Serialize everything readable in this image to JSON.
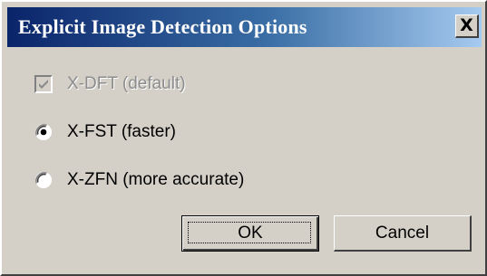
{
  "window": {
    "title": "Explicit Image Detection Options",
    "close_glyph": "X"
  },
  "options": [
    {
      "label": "X-DFT (default)",
      "type": "checkbox",
      "checked": true,
      "disabled": true
    },
    {
      "label": "X-FST (faster)",
      "type": "radio",
      "checked": true,
      "disabled": false
    },
    {
      "label": "X-ZFN (more accurate)",
      "type": "radio",
      "checked": false,
      "disabled": false
    }
  ],
  "buttons": {
    "ok_label": "OK",
    "cancel_label": "Cancel"
  },
  "colors": {
    "titlebar_start": "#0a246a",
    "titlebar_end": "#a6caf0",
    "dialog_bg": "#d4d0c8",
    "disabled_text": "#8c8c8c"
  }
}
